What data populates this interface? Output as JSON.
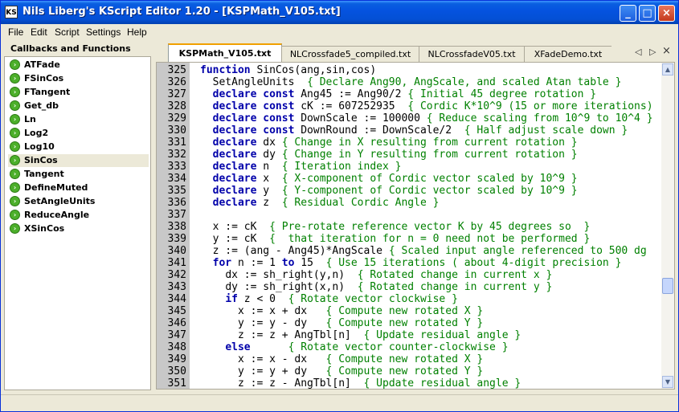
{
  "window": {
    "title": "Nils Liberg's KScript Editor 1.20 - [KSPMath_V105.txt]",
    "app_icon": "KS",
    "minimize": "_",
    "maximize": "□",
    "close": "×"
  },
  "menu": [
    "File",
    "Edit",
    "Script",
    "Settings",
    "Help"
  ],
  "sidebar": {
    "title": "Callbacks and Functions",
    "items": [
      "ATFade",
      "FSinCos",
      "FTangent",
      "Get_db",
      "Ln",
      "Log2",
      "Log10",
      "SinCos",
      "Tangent",
      "DefineMuted",
      "SetAngleUnits",
      "ReduceAngle",
      "XSinCos"
    ],
    "selected": "SinCos",
    "item_icon": "green-bullet-icon"
  },
  "tabs": [
    "KSPMath_V105.txt",
    "NLCrossfade5_compiled.txt",
    "NLCrossfadeV05.txt",
    "XFadeDemo.txt"
  ],
  "active_tab": "KSPMath_V105.txt",
  "tab_nav": {
    "prev": "◁",
    "next": "▷",
    "close": "×"
  },
  "scroll_arrows": {
    "up": "▲",
    "down": "▼"
  },
  "editor": {
    "lines": [
      {
        "n": "325",
        "indent": "",
        "segs": [
          [
            "kw",
            "function"
          ],
          [
            "t",
            " SinCos(ang,sin,cos)"
          ]
        ]
      },
      {
        "n": "326",
        "indent": "  ",
        "segs": [
          [
            "t",
            "SetAngleUnits  "
          ],
          [
            "cm",
            "{ Declare Ang90, AngScale, and scaled Atan table }"
          ]
        ]
      },
      {
        "n": "327",
        "indent": "  ",
        "segs": [
          [
            "kw",
            "declare const"
          ],
          [
            "t",
            " Ang45 := Ang90/2 "
          ],
          [
            "cm",
            "{ Initial 45 degree rotation }"
          ]
        ]
      },
      {
        "n": "328",
        "indent": "  ",
        "segs": [
          [
            "kw",
            "declare const"
          ],
          [
            "t",
            " cK := 607252935  "
          ],
          [
            "cm",
            "{ Cordic K*10^9 (15 or more iterations)"
          ]
        ]
      },
      {
        "n": "329",
        "indent": "  ",
        "segs": [
          [
            "kw",
            "declare const"
          ],
          [
            "t",
            " DownScale := 100000 "
          ],
          [
            "cm",
            "{ Reduce scaling from 10^9 to 10^4 }"
          ]
        ]
      },
      {
        "n": "330",
        "indent": "  ",
        "segs": [
          [
            "kw",
            "declare const"
          ],
          [
            "t",
            " DownRound := DownScale/2  "
          ],
          [
            "cm",
            "{ Half adjust scale down }"
          ]
        ]
      },
      {
        "n": "331",
        "indent": "  ",
        "segs": [
          [
            "kw",
            "declare"
          ],
          [
            "t",
            " dx "
          ],
          [
            "cm",
            "{ Change in X resulting from current rotation }"
          ]
        ]
      },
      {
        "n": "332",
        "indent": "  ",
        "segs": [
          [
            "kw",
            "declare"
          ],
          [
            "t",
            " dy "
          ],
          [
            "cm",
            "{ Change in Y resulting from current rotation }"
          ]
        ]
      },
      {
        "n": "333",
        "indent": "  ",
        "segs": [
          [
            "kw",
            "declare"
          ],
          [
            "t",
            " n  "
          ],
          [
            "cm",
            "{ Iteration index }"
          ]
        ]
      },
      {
        "n": "334",
        "indent": "  ",
        "segs": [
          [
            "kw",
            "declare"
          ],
          [
            "t",
            " x  "
          ],
          [
            "cm",
            "{ X-component of Cordic vector scaled by 10^9 }"
          ]
        ]
      },
      {
        "n": "335",
        "indent": "  ",
        "segs": [
          [
            "kw",
            "declare"
          ],
          [
            "t",
            " y  "
          ],
          [
            "cm",
            "{ Y-component of Cordic vector scaled by 10^9 }"
          ]
        ]
      },
      {
        "n": "336",
        "indent": "  ",
        "segs": [
          [
            "kw",
            "declare"
          ],
          [
            "t",
            " z  "
          ],
          [
            "cm",
            "{ Residual Cordic Angle }"
          ]
        ]
      },
      {
        "n": "337",
        "indent": "",
        "segs": []
      },
      {
        "n": "338",
        "indent": "  ",
        "segs": [
          [
            "t",
            "x := cK  "
          ],
          [
            "cm",
            "{ Pre-rotate reference vector K by 45 degrees so  }"
          ]
        ]
      },
      {
        "n": "339",
        "indent": "  ",
        "segs": [
          [
            "t",
            "y := cK  "
          ],
          [
            "cm",
            "{  that iteration for n = 0 need not be performed }"
          ]
        ]
      },
      {
        "n": "340",
        "indent": "  ",
        "segs": [
          [
            "t",
            "z := (ang - Ang45)*AngScale "
          ],
          [
            "cm",
            "{ Scaled input angle referenced to 500 dg"
          ]
        ]
      },
      {
        "n": "341",
        "indent": "  ",
        "segs": [
          [
            "kw",
            "for"
          ],
          [
            "t",
            " n := 1 "
          ],
          [
            "kw",
            "to"
          ],
          [
            "t",
            " 15  "
          ],
          [
            "cm",
            "{ Use 15 iterations ( about 4-digit precision }"
          ]
        ]
      },
      {
        "n": "342",
        "indent": "    ",
        "segs": [
          [
            "t",
            "dx := sh_right(y,n)  "
          ],
          [
            "cm",
            "{ Rotated change in current x }"
          ]
        ]
      },
      {
        "n": "343",
        "indent": "    ",
        "segs": [
          [
            "t",
            "dy := sh_right(x,n)  "
          ],
          [
            "cm",
            "{ Rotated change in current y }"
          ]
        ]
      },
      {
        "n": "344",
        "indent": "    ",
        "segs": [
          [
            "kw",
            "if"
          ],
          [
            "t",
            " z < 0  "
          ],
          [
            "cm",
            "{ Rotate vector clockwise }"
          ]
        ]
      },
      {
        "n": "345",
        "indent": "      ",
        "segs": [
          [
            "t",
            "x := x + dx   "
          ],
          [
            "cm",
            "{ Compute new rotated X }"
          ]
        ]
      },
      {
        "n": "346",
        "indent": "      ",
        "segs": [
          [
            "t",
            "y := y - dy   "
          ],
          [
            "cm",
            "{ Compute new rotated Y }"
          ]
        ]
      },
      {
        "n": "347",
        "indent": "      ",
        "segs": [
          [
            "t",
            "z := z + AngTbl[n]  "
          ],
          [
            "cm",
            "{ Update residual angle }"
          ]
        ]
      },
      {
        "n": "348",
        "indent": "    ",
        "segs": [
          [
            "kw",
            "else"
          ],
          [
            "t",
            "      "
          ],
          [
            "cm",
            "{ Rotate vector counter-clockwise }"
          ]
        ]
      },
      {
        "n": "349",
        "indent": "      ",
        "segs": [
          [
            "t",
            "x := x - dx   "
          ],
          [
            "cm",
            "{ Compute new rotated X }"
          ]
        ]
      },
      {
        "n": "350",
        "indent": "      ",
        "segs": [
          [
            "t",
            "y := y + dy   "
          ],
          [
            "cm",
            "{ Compute new rotated Y }"
          ]
        ]
      },
      {
        "n": "351",
        "indent": "      ",
        "segs": [
          [
            "t",
            "z := z - AngTbl[n]  "
          ],
          [
            "cm",
            "{ Update residual angle }"
          ]
        ]
      }
    ]
  }
}
